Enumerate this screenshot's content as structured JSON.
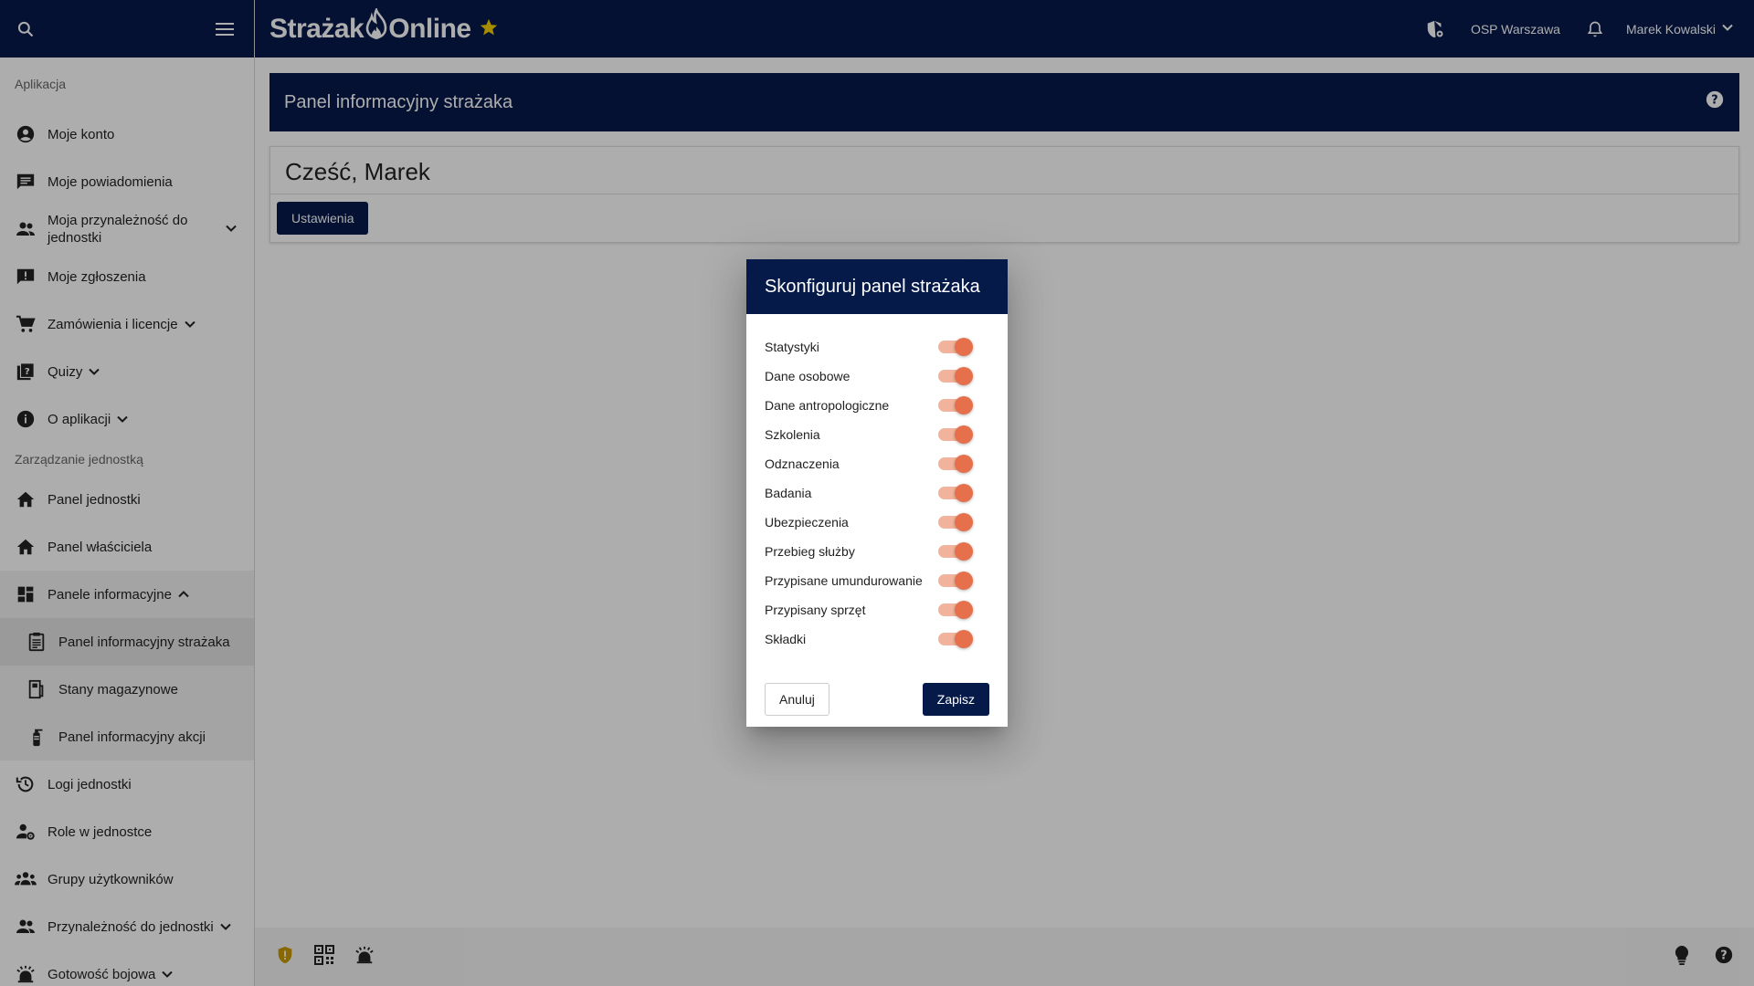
{
  "brand": {
    "name_part1": "Strażak",
    "name_part2": "Online"
  },
  "topbar": {
    "unit_name": "OSP Warszawa",
    "user_name": "Marek Kowalski"
  },
  "sidebar": {
    "section_app": "Aplikacja",
    "items_app": [
      {
        "label": "Moje konto",
        "icon": "account-circle-icon"
      },
      {
        "label": "Moje powiadomienia",
        "icon": "message-icon"
      },
      {
        "label": "Moja przynależność do jednostki",
        "icon": "group-icon"
      },
      {
        "label": "Moje zgłoszenia",
        "icon": "feedback-icon"
      },
      {
        "label": "Zamówienia i licencje",
        "icon": "cart-icon"
      },
      {
        "label": "Quizy",
        "icon": "quiz-icon"
      },
      {
        "label": "O aplikacji",
        "icon": "info-icon"
      }
    ],
    "section_unit": "Zarządzanie jednostką",
    "items_unit": [
      {
        "label": "Panel jednostki",
        "icon": "home-icon"
      },
      {
        "label": "Panel właściciela",
        "icon": "home-icon"
      },
      {
        "label": "Panele informacyjne",
        "icon": "dashboard-icon"
      }
    ],
    "sub_items": [
      {
        "label": "Panel informacyjny strażaka",
        "icon": "firefighter-doc-icon"
      },
      {
        "label": "Stany magazynowe",
        "icon": "warehouse-icon"
      },
      {
        "label": "Panel informacyjny akcji",
        "icon": "extinguisher-icon"
      }
    ],
    "items_after": [
      {
        "label": "Logi jednostki",
        "icon": "history-icon"
      },
      {
        "label": "Role w jednostce",
        "icon": "user-gear-icon"
      },
      {
        "label": "Grupy użytkowników",
        "icon": "groups-icon"
      },
      {
        "label": "Przynależność do jednostki",
        "icon": "group-icon"
      },
      {
        "label": "Gotowość bojowa",
        "icon": "alarm-light-icon"
      }
    ]
  },
  "main": {
    "page_title": "Panel informacyjny strażaka",
    "greeting": "Cześć, Marek",
    "settings_button": "Ustawienia"
  },
  "dialog": {
    "title": "Skonfiguruj panel strażaka",
    "options": [
      {
        "label": "Statystyki",
        "enabled": true
      },
      {
        "label": "Dane osobowe",
        "enabled": true
      },
      {
        "label": "Dane antropologiczne",
        "enabled": true
      },
      {
        "label": "Szkolenia",
        "enabled": true
      },
      {
        "label": "Odznaczenia",
        "enabled": true
      },
      {
        "label": "Badania",
        "enabled": true
      },
      {
        "label": "Ubezpieczenia",
        "enabled": true
      },
      {
        "label": "Przebieg służby",
        "enabled": true
      },
      {
        "label": "Przypisane umundurowanie",
        "enabled": true
      },
      {
        "label": "Przypisany sprzęt",
        "enabled": true
      },
      {
        "label": "Składki",
        "enabled": true
      }
    ],
    "cancel_button": "Anuluj",
    "save_button": "Zapisz"
  },
  "colors": {
    "navy": "#061a4a",
    "toggle_on": "#e5704b",
    "toggle_track": "#f2b39d",
    "star": "#f5d000"
  }
}
